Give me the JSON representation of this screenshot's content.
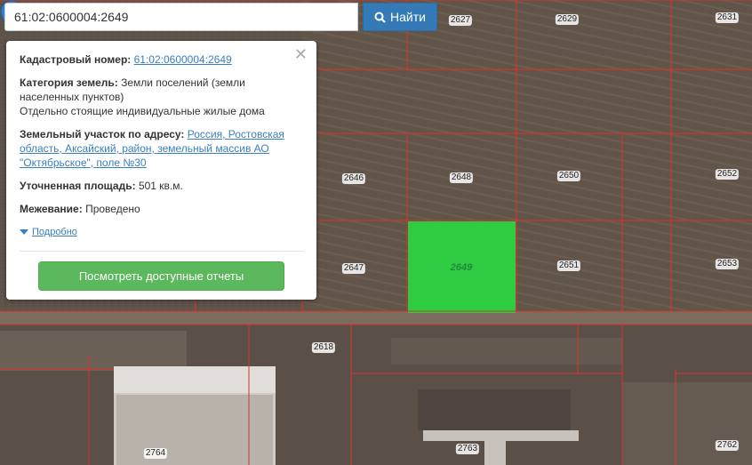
{
  "search": {
    "query": "61:02:0600004:2649",
    "button_label": "Найти",
    "button_icon": "search-icon"
  },
  "popup": {
    "cadastral_label": "Кадастровый номер:",
    "cadastral_value": "61:02:0600004:2649",
    "category_label": "Категория земель:",
    "category_value": "Земли поселений (земли населенных пунктов)",
    "use_value": "Отдельно стоящие индивидуальные жилые дома",
    "address_label": "Земельный участок по адресу:",
    "address_value": "Россия, Ростовская область, Аксайский, район, земельный массив АО \"Октябрьское\", поле №30",
    "area_label": "Уточненная площадь:",
    "area_value": "501 кв.м.",
    "survey_label": "Межевание:",
    "survey_value": "Проведено",
    "details_label": "Подробно",
    "reports_button": "Посмотреть доступные отчеты",
    "close_icon": "close-icon"
  },
  "map": {
    "selected_parcel": "2649",
    "selected_color": "#2ecc40",
    "boundary_color": "#e0302a",
    "parcel_labels": [
      "2627",
      "2629",
      "2631",
      "2646",
      "2648",
      "2650",
      "2652",
      "2647",
      "2649",
      "2651",
      "2653",
      "2618",
      "2764",
      "2763",
      "2762"
    ],
    "marker_icon": "map-marker-icon",
    "marker_color": "#2f7fcf"
  }
}
